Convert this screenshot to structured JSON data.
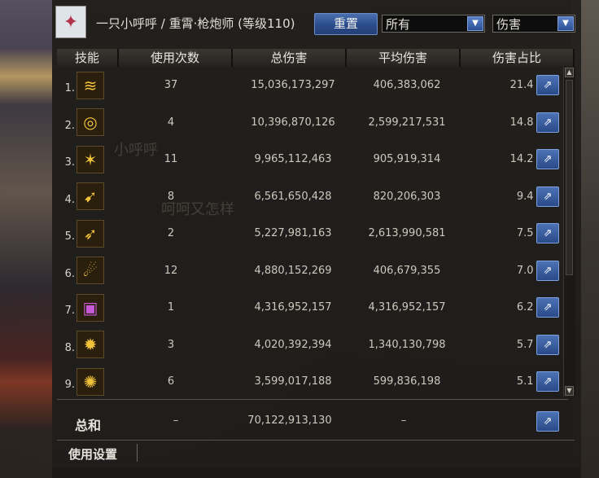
{
  "header": {
    "avatar_icon": "player-avatar-icon",
    "character": "一只小呼呼 / 重霄·枪炮师 (等级110)",
    "reset_label": "重置",
    "filter_select": "所有",
    "metric_select": "伤害"
  },
  "columns": {
    "skill": "技能",
    "uses": "使用次数",
    "total": "总伤害",
    "avg": "平均伤害",
    "share": "伤害占比"
  },
  "rows": [
    {
      "index": "1.",
      "icon": "skill-icon-1",
      "uses": "37",
      "total": "15,036,173,297",
      "avg": "406,383,062",
      "pct": "21.4 %"
    },
    {
      "index": "2.",
      "icon": "skill-icon-2",
      "uses": "4",
      "total": "10,396,870,126",
      "avg": "2,599,217,531",
      "pct": "14.8 %"
    },
    {
      "index": "3.",
      "icon": "skill-icon-3",
      "uses": "11",
      "total": "9,965,112,463",
      "avg": "905,919,314",
      "pct": "14.2 %"
    },
    {
      "index": "4.",
      "icon": "skill-icon-4",
      "uses": "8",
      "total": "6,561,650,428",
      "avg": "820,206,303",
      "pct": "9.4 %"
    },
    {
      "index": "5.",
      "icon": "skill-icon-5",
      "uses": "2",
      "total": "5,227,981,163",
      "avg": "2,613,990,581",
      "pct": "7.5 %"
    },
    {
      "index": "6.",
      "icon": "skill-icon-6",
      "uses": "12",
      "total": "4,880,152,269",
      "avg": "406,679,355",
      "pct": "7.0 %"
    },
    {
      "index": "7.",
      "icon": "skill-icon-7",
      "uses": "1",
      "total": "4,316,952,157",
      "avg": "4,316,952,157",
      "pct": "6.2 %"
    },
    {
      "index": "8.",
      "icon": "skill-icon-8",
      "uses": "3",
      "total": "4,020,392,394",
      "avg": "1,340,130,798",
      "pct": "5.7 %"
    },
    {
      "index": "9.",
      "icon": "skill-icon-9",
      "uses": "6",
      "total": "3,599,017,188",
      "avg": "599,836,198",
      "pct": "5.1 %"
    }
  ],
  "summary": {
    "label": "总和",
    "uses": "–",
    "total": "70,122,913,130",
    "avg": "–"
  },
  "footer": {
    "settings_label": "使用设置"
  },
  "overlay_chat": [
    "小呼呼",
    "呵呵又怎样"
  ],
  "colors": {
    "accent_blue": "#2b4c8b",
    "panel_bg": "#1e1c1a"
  }
}
